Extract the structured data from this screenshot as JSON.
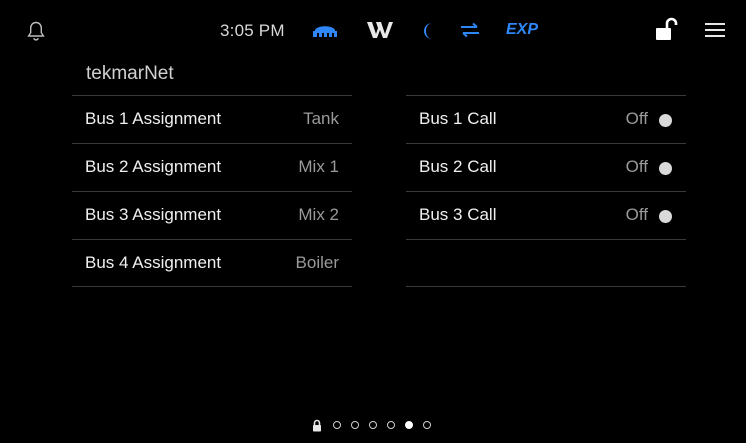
{
  "status_bar": {
    "time": "3:05 PM",
    "exp_label": "EXP",
    "icons": [
      "bell-icon",
      "network-icon",
      "w-logo-icon",
      "moon-icon",
      "exchange-arrows-icon",
      "unlocked-padlock-icon",
      "hamburger-menu-icon"
    ],
    "colors": {
      "accent": "#2f86f6"
    }
  },
  "page": {
    "title": "tekmarNet"
  },
  "assignments": [
    {
      "label": "Bus 1 Assignment",
      "value": "Tank"
    },
    {
      "label": "Bus 2 Assignment",
      "value": "Mix 1"
    },
    {
      "label": "Bus 3 Assignment",
      "value": "Mix 2"
    },
    {
      "label": "Bus 4 Assignment",
      "value": "Boiler"
    }
  ],
  "calls": [
    {
      "label": "Bus 1 Call",
      "value": "Off"
    },
    {
      "label": "Bus 2 Call",
      "value": "Off"
    },
    {
      "label": "Bus 3 Call",
      "value": "Off"
    }
  ],
  "pager": {
    "page_count": 6,
    "active_page": 5
  }
}
